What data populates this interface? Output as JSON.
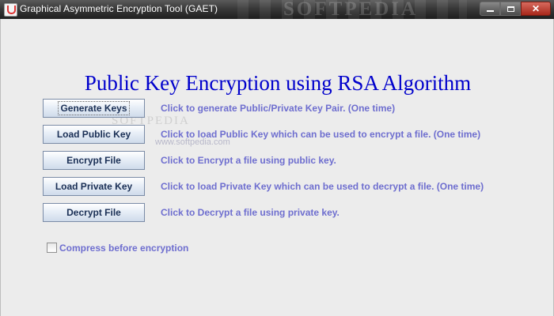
{
  "window": {
    "title": "Graphical Asymmetric Encryption Tool (GAET)",
    "watermark": "SOFTPEDIA",
    "controls": [
      "minimize",
      "maximize",
      "close"
    ]
  },
  "heading": "Public Key Encryption using RSA Algorithm",
  "actions": [
    {
      "label": "Generate Keys",
      "description": "Click to generate Public/Private Key Pair. (One time)"
    },
    {
      "label": "Load Public Key",
      "description": "Click to load Public Key which can be used to encrypt a file. (One time)"
    },
    {
      "label": "Encrypt File",
      "description": "Click to Encrypt a file using public key."
    },
    {
      "label": "Load Private Key",
      "description": "Click to load Private Key which can be used to decrypt a file. (One time)"
    },
    {
      "label": "Decrypt File",
      "description": "Click to Decrypt a file using private key."
    }
  ],
  "options": {
    "compress_label": "Compress before encryption",
    "compress_checked": false
  },
  "watermarks": {
    "center_logo": "SOFTPEDIA",
    "center_url": "www.softpedia.com"
  },
  "colors": {
    "heading": "#0000cc",
    "description_text": "#6e6ecf",
    "button_text": "#1a2f55"
  }
}
